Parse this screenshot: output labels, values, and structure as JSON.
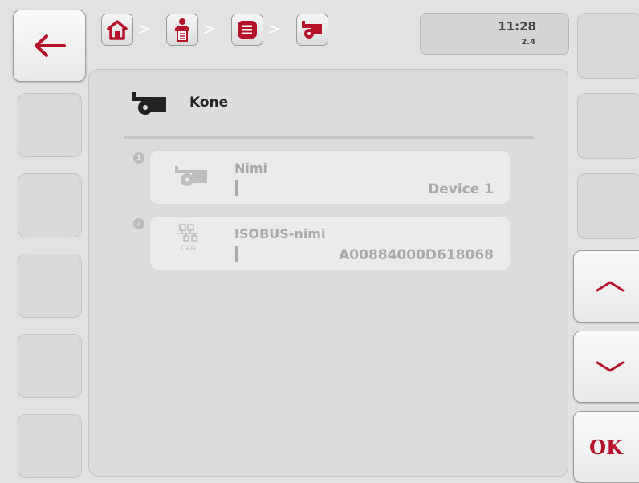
{
  "header": {
    "breadcrumb": [
      "home-icon",
      "operator-icon",
      "list-icon",
      "machine-icon"
    ],
    "separator": ">",
    "time": "11:28",
    "version": "2.4"
  },
  "page": {
    "title": "Kone",
    "title_icon": "machine-icon"
  },
  "rows": [
    {
      "index": "1",
      "icon": "machine-icon",
      "label": "Nimi",
      "value": "Device 1"
    },
    {
      "index": "2",
      "icon": "can-network-icon",
      "icon_caption": "CAN",
      "label": "ISOBUS-nimi",
      "value": "A00884000D618068"
    }
  ],
  "softkeys": {
    "back": "back-arrow-icon",
    "scroll_up": "chevron-up-icon",
    "scroll_down": "chevron-down-icon",
    "ok_label": "OK"
  },
  "colors": {
    "accent_red": "#b5122a",
    "icon_dark": "#222222",
    "disabled_text": "#a9a9a9"
  }
}
